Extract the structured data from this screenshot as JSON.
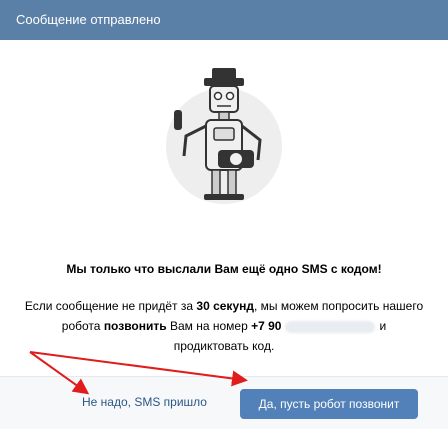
{
  "header": {
    "title": "Сообщение отправлено"
  },
  "content": {
    "headline": "Мы только что выслали Вам ещё одно SMS с кодом!",
    "body_prefix": "Если сообщение не придёт за",
    "body_seconds": "30 секунд",
    "body_mid": ", мы можем попросить нашего робота",
    "body_call": "позвонить",
    "body_to": "Вам на номер",
    "phone_partial": "+7 90",
    "body_tail": "и продиктовать код."
  },
  "buttons": {
    "decline_label": "Не надо, SMS пришло",
    "call_label": "Да, пусть робот позвонит"
  },
  "annotations": {
    "arrow_color": "#e01c1c"
  },
  "colors": {
    "header_bg": "#5b80a8",
    "primary_button": "#5181b8",
    "link": "#2a5885"
  },
  "icons": {
    "illustration": "robot-illustration"
  }
}
